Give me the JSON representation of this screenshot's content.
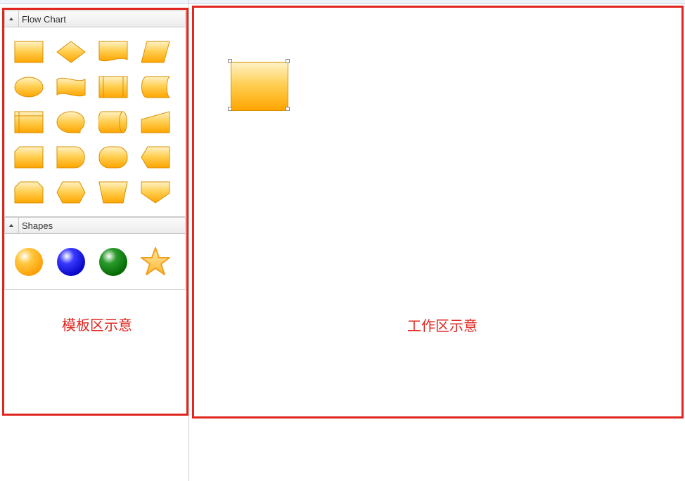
{
  "flowchart_panel": {
    "title": "Flow Chart",
    "items": [
      "process",
      "decision",
      "document",
      "data",
      "terminator",
      "punched-tape",
      "predefined-process",
      "stored-data",
      "internal-storage",
      "sequential-data",
      "direct-data",
      "manual-input",
      "card",
      "delay",
      "display-oval",
      "preparation",
      "loop-limit",
      "hexagon",
      "manual-operation",
      "off-page-connector"
    ]
  },
  "shapes_panel": {
    "title": "Shapes",
    "items": [
      "orange-sphere",
      "blue-sphere",
      "green-sphere",
      "star"
    ]
  },
  "captions": {
    "template_area": "模板区示意",
    "work_area": "工作区示意"
  },
  "colors": {
    "shape_fill_light": "#fff2c7",
    "shape_fill_dark": "#ffa500",
    "shape_stroke": "#d99000",
    "annotation": "#e0261f"
  }
}
